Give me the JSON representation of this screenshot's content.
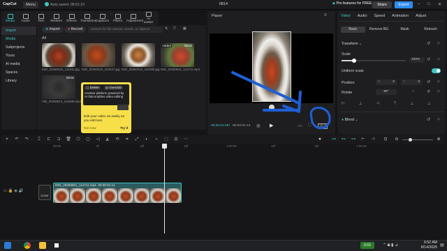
{
  "app": {
    "logo": "CapCut",
    "menu_label": "Menu",
    "autosave": "Auto saved: 06:51:10",
    "project_title": "0814",
    "pro_features": "Pro features for FREE",
    "share_label": "Share",
    "export_label": "Export"
  },
  "left_tabs": [
    {
      "label": "Media"
    },
    {
      "label": "Audio"
    },
    {
      "label": "Text"
    },
    {
      "label": "Stickers"
    },
    {
      "label": "Effects"
    },
    {
      "label": "Transitions"
    },
    {
      "label": "Captions"
    },
    {
      "label": "Filters"
    },
    {
      "label": "Adjustment"
    },
    {
      "label": "AI avatar"
    }
  ],
  "left_nav": [
    {
      "label": "Import"
    },
    {
      "label": "Media"
    },
    {
      "label": "Subprojects"
    },
    {
      "label": "Yours"
    },
    {
      "label": "AI media"
    },
    {
      "label": "Spaces"
    },
    {
      "label": "Library"
    }
  ],
  "media": {
    "import_label": "Import",
    "record_label": "Record",
    "search_placeholder": "Search for file names, words, or objects",
    "all_label": "All",
    "added_label": "Added",
    "thumbs": [
      {
        "name": "IMG_20250315_115311.jpg"
      },
      {
        "name": "IMG_20250310_222347.jpg"
      },
      {
        "name": "IMG_20250310_222358.jpg"
      },
      {
        "name": "IMG_20250811_114711.mp4",
        "duration": "00:02"
      },
      {
        "name": "VID_20250814_215938.mp4",
        "duration": "00:02"
      }
    ]
  },
  "tooltip": {
    "delete_label": "Delete",
    "overdub_label": "Overdub",
    "body_text": "creative platform powered by AI that enables video editing",
    "caption": "Edit your video as easily as you edit text.",
    "not_now": "Not now",
    "try_it": "Try it"
  },
  "player": {
    "title": "Player",
    "current_time": "00:00:01:08",
    "total_time": "00:00:01:14"
  },
  "props": {
    "tabs": [
      {
        "label": "Video"
      },
      {
        "label": "Audio"
      },
      {
        "label": "Speed"
      },
      {
        "label": "Animation"
      },
      {
        "label": "Adjust"
      }
    ],
    "subtabs": [
      {
        "label": "Basic"
      },
      {
        "label": "Remove BG"
      },
      {
        "label": "Mask"
      },
      {
        "label": "Retouch"
      }
    ],
    "transform_label": "Transform",
    "scale_label": "Scale",
    "scale_value": "100%",
    "scale_fraction": 0.2,
    "uniform_scale_label": "Uniform scale",
    "position_label": "Position",
    "x_label": "X",
    "x_value": "0",
    "y_label": "Y",
    "y_value": "0",
    "rotate_label": "Rotate",
    "rotate_value": "90°",
    "blend_label": "Blend"
  },
  "timeline": {
    "ticks": [
      "00:00",
      "5f",
      "10f",
      "15f",
      "1:00:05",
      "10f",
      "15f",
      "1:00:10"
    ],
    "clip_name": "IMG_20250811_114711.mp4",
    "clip_duration": "00:00:01:14",
    "cover_label": "Cover"
  },
  "taskbar": {
    "time": "6:52 AM",
    "date": "8/14/2025",
    "counter": "3:01"
  },
  "colors": {
    "accent": "#3fc6c4",
    "export": "#2f8cf0",
    "tooltip": "#f7df4a",
    "annotation": "#1f5fd6"
  }
}
